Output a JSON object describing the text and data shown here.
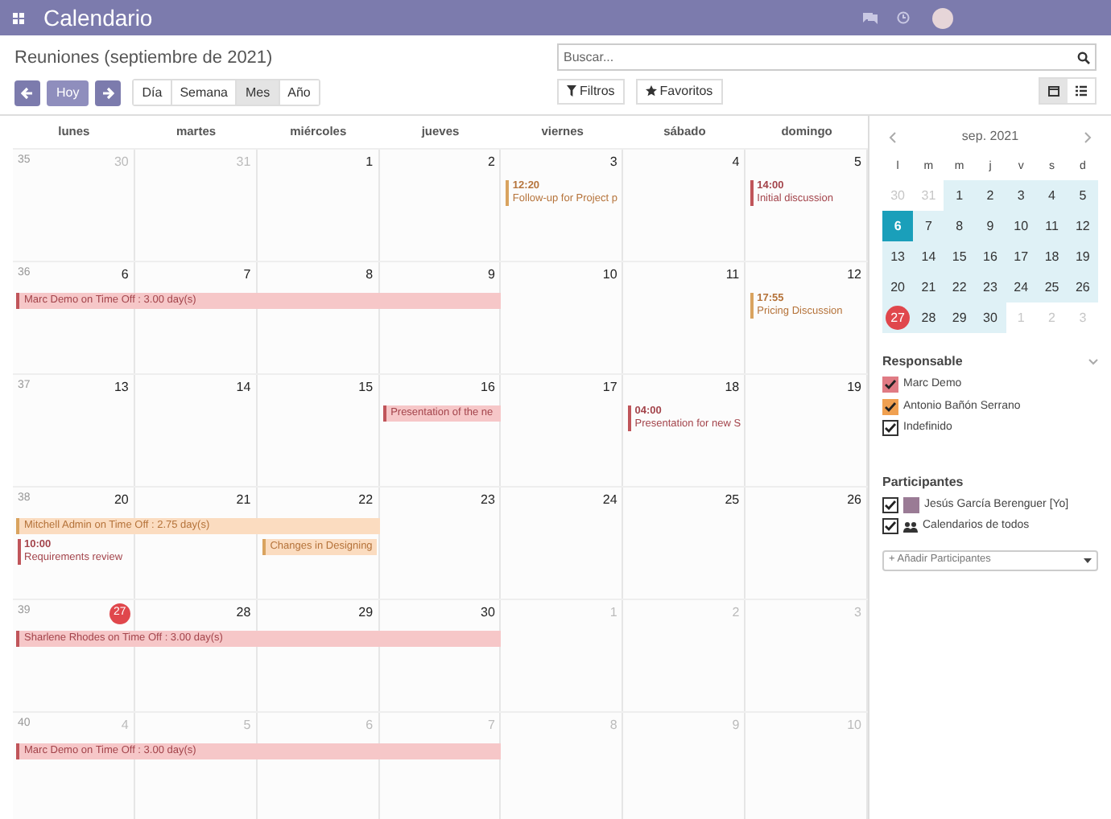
{
  "navbar": {
    "title": "Calendario"
  },
  "control_panel": {
    "title": "Reuniones (septiembre de 2021)",
    "today_button": "Hoy",
    "scales": [
      {
        "label": "Día",
        "selected": false
      },
      {
        "label": "Semana",
        "selected": false
      },
      {
        "label": "Mes",
        "selected": true
      },
      {
        "label": "Año",
        "selected": false
      }
    ],
    "search": {
      "placeholder": "Buscar..."
    },
    "filters_button": "Filtros",
    "favorites_button": "Favoritos",
    "views": [
      {
        "kind": "calendar",
        "selected": true
      },
      {
        "kind": "list",
        "selected": false
      }
    ]
  },
  "calendar": {
    "weekdays": [
      "lunes",
      "martes",
      "miércoles",
      "jueves",
      "viernes",
      "sábado",
      "domingo"
    ],
    "weeks": [
      {
        "number": "35",
        "days": [
          {
            "label": "30",
            "muted": true,
            "today": false
          },
          {
            "label": "31",
            "muted": true,
            "today": false
          },
          {
            "label": "1",
            "muted": false,
            "today": false
          },
          {
            "label": "2",
            "muted": false,
            "today": false
          },
          {
            "label": "3",
            "muted": false,
            "today": false,
            "events": [
              {
                "kind": "timed",
                "time": "12:20",
                "title": "Follow-up for Project p",
                "color": "#d9a35f"
              }
            ]
          },
          {
            "label": "4",
            "muted": false,
            "today": false
          },
          {
            "label": "5",
            "muted": false,
            "today": false,
            "events": [
              {
                "kind": "timed",
                "time": "14:00",
                "title": "Initial discussion",
                "color": "#c0555a"
              }
            ]
          }
        ]
      },
      {
        "number": "36",
        "days": [
          {
            "label": "6",
            "muted": false,
            "today": false,
            "events": [
              {
                "kind": "bar_start",
                "title": "Marc Demo on Time Off : 3.00 day(s)",
                "color": "#c0555a"
              }
            ]
          },
          {
            "label": "7",
            "muted": false,
            "today": false,
            "events": [
              {
                "kind": "bar_continue"
              }
            ]
          },
          {
            "label": "8",
            "muted": false,
            "today": false,
            "events": [
              {
                "kind": "bar_continue"
              }
            ]
          },
          {
            "label": "9",
            "muted": false,
            "today": false,
            "events": [
              {
                "kind": "bar_continue"
              }
            ]
          },
          {
            "label": "10",
            "muted": false,
            "today": false
          },
          {
            "label": "11",
            "muted": false,
            "today": false
          },
          {
            "label": "12",
            "muted": false,
            "today": false,
            "events": [
              {
                "kind": "timed",
                "time": "17:55",
                "title": "Pricing Discussion",
                "color": "#d9a35f"
              }
            ]
          }
        ]
      },
      {
        "number": "37",
        "days": [
          {
            "label": "13",
            "muted": false,
            "today": false
          },
          {
            "label": "14",
            "muted": false,
            "today": false
          },
          {
            "label": "15",
            "muted": false,
            "today": false
          },
          {
            "label": "16",
            "muted": false,
            "today": false,
            "events": [
              {
                "kind": "bar_start",
                "title": "Presentation of the ne",
                "color": "#c0555a"
              }
            ]
          },
          {
            "label": "17",
            "muted": false,
            "today": false
          },
          {
            "label": "18",
            "muted": false,
            "today": false,
            "events": [
              {
                "kind": "timed",
                "time": "04:00",
                "title": "Presentation for new S",
                "color": "#c0555a"
              }
            ]
          },
          {
            "label": "19",
            "muted": false,
            "today": false
          }
        ]
      },
      {
        "number": "38",
        "days": [
          {
            "label": "20",
            "muted": false,
            "today": false,
            "events": [
              {
                "kind": "bar_start",
                "title": "Mitchell Admin on Time Off : 2.75 day(s)",
                "color": "#d9a35f"
              },
              {
                "kind": "timed",
                "time": "10:00",
                "title": "Requirements review",
                "color": "#c0555a"
              }
            ]
          },
          {
            "label": "21",
            "muted": false,
            "today": false,
            "events": [
              {
                "kind": "bar_continue"
              }
            ]
          },
          {
            "label": "22",
            "muted": false,
            "today": false,
            "events": [
              {
                "kind": "bar_continue"
              },
              {
                "kind": "allday",
                "title": "Changes in Designing",
                "color": "#d9a35f"
              }
            ]
          },
          {
            "label": "23",
            "muted": false,
            "today": false
          },
          {
            "label": "24",
            "muted": false,
            "today": false
          },
          {
            "label": "25",
            "muted": false,
            "today": false
          },
          {
            "label": "26",
            "muted": false,
            "today": false
          }
        ]
      },
      {
        "number": "39",
        "days": [
          {
            "label": "27",
            "muted": false,
            "today": true,
            "events": [
              {
                "kind": "bar_start",
                "title": "Sharlene Rhodes on Time Off : 3.00 day(s)",
                "color": "#c0555a"
              }
            ]
          },
          {
            "label": "28",
            "muted": false,
            "today": false,
            "events": [
              {
                "kind": "bar_continue"
              }
            ]
          },
          {
            "label": "29",
            "muted": false,
            "today": false,
            "events": [
              {
                "kind": "bar_continue"
              }
            ]
          },
          {
            "label": "30",
            "muted": false,
            "today": false,
            "events": [
              {
                "kind": "bar_continue"
              }
            ]
          },
          {
            "label": "1",
            "muted": true,
            "today": false
          },
          {
            "label": "2",
            "muted": true,
            "today": false
          },
          {
            "label": "3",
            "muted": true,
            "today": false
          }
        ]
      },
      {
        "number": "40",
        "days": [
          {
            "label": "4",
            "muted": true,
            "today": false,
            "events": [
              {
                "kind": "bar_start",
                "title": "Marc Demo on Time Off : 3.00 day(s)",
                "color": "#c0555a"
              }
            ]
          },
          {
            "label": "5",
            "muted": true,
            "today": false,
            "events": [
              {
                "kind": "bar_continue"
              }
            ]
          },
          {
            "label": "6",
            "muted": true,
            "today": false,
            "events": [
              {
                "kind": "bar_continue"
              }
            ]
          },
          {
            "label": "7",
            "muted": true,
            "today": false,
            "events": [
              {
                "kind": "bar_continue"
              }
            ]
          },
          {
            "label": "8",
            "muted": true,
            "today": false
          },
          {
            "label": "9",
            "muted": true,
            "today": false
          },
          {
            "label": "10",
            "muted": true,
            "today": false
          }
        ]
      }
    ]
  },
  "sidebar": {
    "mini_calendar": {
      "title": "sep. 2021",
      "weekdays": [
        "l",
        "m",
        "m",
        "j",
        "v",
        "s",
        "d"
      ],
      "days": [
        {
          "label": "30",
          "muted": true,
          "highlighted": false,
          "today": false,
          "selected": false
        },
        {
          "label": "31",
          "muted": true,
          "highlighted": false,
          "today": false,
          "selected": false
        },
        {
          "label": "1",
          "muted": false,
          "highlighted": true,
          "today": false,
          "selected": false
        },
        {
          "label": "2",
          "muted": false,
          "highlighted": true,
          "today": false,
          "selected": false
        },
        {
          "label": "3",
          "muted": false,
          "highlighted": true,
          "today": false,
          "selected": false
        },
        {
          "label": "4",
          "muted": false,
          "highlighted": true,
          "today": false,
          "selected": false
        },
        {
          "label": "5",
          "muted": false,
          "highlighted": true,
          "today": false,
          "selected": false
        },
        {
          "label": "6",
          "muted": false,
          "highlighted": true,
          "today": false,
          "selected": true
        },
        {
          "label": "7",
          "muted": false,
          "highlighted": true,
          "today": false,
          "selected": false
        },
        {
          "label": "8",
          "muted": false,
          "highlighted": true,
          "today": false,
          "selected": false
        },
        {
          "label": "9",
          "muted": false,
          "highlighted": true,
          "today": false,
          "selected": false
        },
        {
          "label": "10",
          "muted": false,
          "highlighted": true,
          "today": false,
          "selected": false
        },
        {
          "label": "11",
          "muted": false,
          "highlighted": true,
          "today": false,
          "selected": false
        },
        {
          "label": "12",
          "muted": false,
          "highlighted": true,
          "today": false,
          "selected": false
        },
        {
          "label": "13",
          "muted": false,
          "highlighted": true,
          "today": false,
          "selected": false
        },
        {
          "label": "14",
          "muted": false,
          "highlighted": true,
          "today": false,
          "selected": false
        },
        {
          "label": "15",
          "muted": false,
          "highlighted": true,
          "today": false,
          "selected": false
        },
        {
          "label": "16",
          "muted": false,
          "highlighted": true,
          "today": false,
          "selected": false
        },
        {
          "label": "17",
          "muted": false,
          "highlighted": true,
          "today": false,
          "selected": false
        },
        {
          "label": "18",
          "muted": false,
          "highlighted": true,
          "today": false,
          "selected": false
        },
        {
          "label": "19",
          "muted": false,
          "highlighted": true,
          "today": false,
          "selected": false
        },
        {
          "label": "20",
          "muted": false,
          "highlighted": true,
          "today": false,
          "selected": false
        },
        {
          "label": "21",
          "muted": false,
          "highlighted": true,
          "today": false,
          "selected": false
        },
        {
          "label": "22",
          "muted": false,
          "highlighted": true,
          "today": false,
          "selected": false
        },
        {
          "label": "23",
          "muted": false,
          "highlighted": true,
          "today": false,
          "selected": false
        },
        {
          "label": "24",
          "muted": false,
          "highlighted": true,
          "today": false,
          "selected": false
        },
        {
          "label": "25",
          "muted": false,
          "highlighted": true,
          "today": false,
          "selected": false
        },
        {
          "label": "26",
          "muted": false,
          "highlighted": true,
          "today": false,
          "selected": false
        },
        {
          "label": "27",
          "muted": false,
          "highlighted": true,
          "today": true,
          "selected": false
        },
        {
          "label": "28",
          "muted": false,
          "highlighted": true,
          "today": false,
          "selected": false
        },
        {
          "label": "29",
          "muted": false,
          "highlighted": true,
          "today": false,
          "selected": false
        },
        {
          "label": "30",
          "muted": false,
          "highlighted": true,
          "today": false,
          "selected": false
        },
        {
          "label": "1",
          "muted": true,
          "highlighted": false,
          "today": false,
          "selected": false
        },
        {
          "label": "2",
          "muted": true,
          "highlighted": false,
          "today": false,
          "selected": false
        },
        {
          "label": "3",
          "muted": true,
          "highlighted": false,
          "today": false,
          "selected": false
        }
      ]
    },
    "responsible": {
      "title": "Responsable",
      "items": [
        {
          "label": "Marc Demo",
          "checked": true,
          "color": "#e07b84"
        },
        {
          "label": "Antonio Bañón Serrano",
          "checked": true,
          "color": "#f0a050"
        },
        {
          "label": "Indefinido",
          "checked": true
        }
      ]
    },
    "attendees": {
      "title": "Participantes",
      "items": [
        {
          "label": "Jesús García Berenguer [Yo]",
          "checked": true,
          "kind": "person"
        },
        {
          "label": "Calendarios de todos",
          "checked": true,
          "kind": "group"
        }
      ],
      "add_placeholder": "+ Añadir Participantes"
    }
  }
}
